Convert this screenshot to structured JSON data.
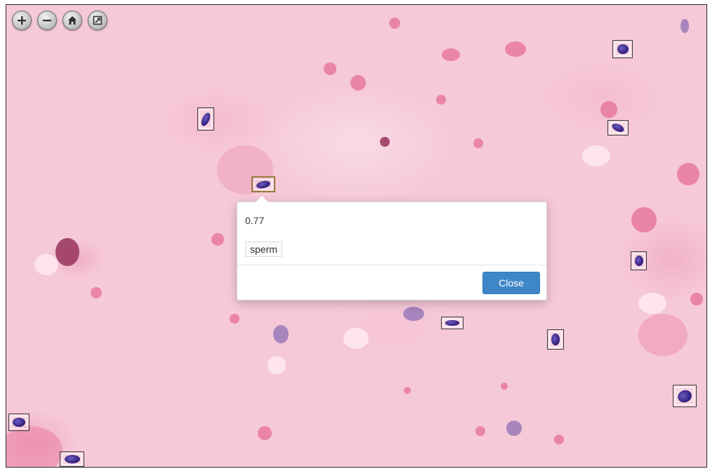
{
  "viewer": {
    "controls": [
      {
        "name": "zoom-in-icon",
        "label": "+"
      },
      {
        "name": "zoom-out-icon",
        "label": "−"
      },
      {
        "name": "home-icon",
        "label": "home"
      },
      {
        "name": "fullscreen-icon",
        "label": "fullscreen"
      }
    ],
    "colors": {
      "background": "#f6c9d8",
      "detection_border": "#3a3a3a",
      "selected_border": "#9b7a3a",
      "close_button": "#3f86c7"
    }
  },
  "popup": {
    "score": "0.77",
    "label": "sperm",
    "close_label": "Close"
  }
}
